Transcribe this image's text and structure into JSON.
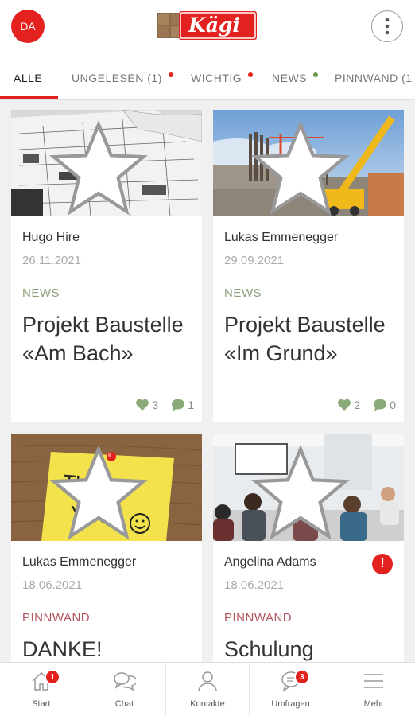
{
  "header": {
    "avatar_initials": "DA",
    "logo_text": "Kägi"
  },
  "tabs": [
    {
      "label": "ALLE",
      "active": true
    },
    {
      "label": "UNGELESEN (1)",
      "dot_color": "#e3211f"
    },
    {
      "label": "WICHTIG",
      "dot_color": "#e3211f"
    },
    {
      "label": "NEWS",
      "dot_color": "#6a9a4a"
    },
    {
      "label": "PINNWAND (1"
    }
  ],
  "colors": {
    "brand_red": "#e3211f",
    "news_category": "#8aa07a",
    "pinnwand_category": "#b05560"
  },
  "posts": [
    {
      "author": "Hugo Hire",
      "date": "26.11.2021",
      "category": "NEWS",
      "title": "Projekt Baustelle «Am Bach»",
      "likes": "3",
      "comments": "1",
      "image": "blueprint"
    },
    {
      "author": "Lukas Emmenegger",
      "date": "29.09.2021",
      "category": "NEWS",
      "title": "Projekt Baustelle «Im Grund»",
      "likes": "2",
      "comments": "0",
      "image": "construction-site"
    },
    {
      "author": "Lukas Emmenegger",
      "date": "18.06.2021",
      "category": "PINNWAND",
      "title": "DANKE!",
      "image": "thank-you-note",
      "note_text_1": "THANK",
      "note_text_2": "YOU!"
    },
    {
      "author": "Angelina Adams",
      "date": "18.06.2021",
      "category": "PINNWAND",
      "title": "Schulung",
      "image": "training-room",
      "important": true
    }
  ],
  "bottom_nav": [
    {
      "label": "Start",
      "icon": "home-icon",
      "badge": "1"
    },
    {
      "label": "Chat",
      "icon": "chat-icon"
    },
    {
      "label": "Kontakte",
      "icon": "contacts-icon"
    },
    {
      "label": "Umfragen",
      "icon": "survey-icon",
      "badge": "3"
    },
    {
      "label": "Mehr",
      "icon": "menu-icon"
    }
  ]
}
